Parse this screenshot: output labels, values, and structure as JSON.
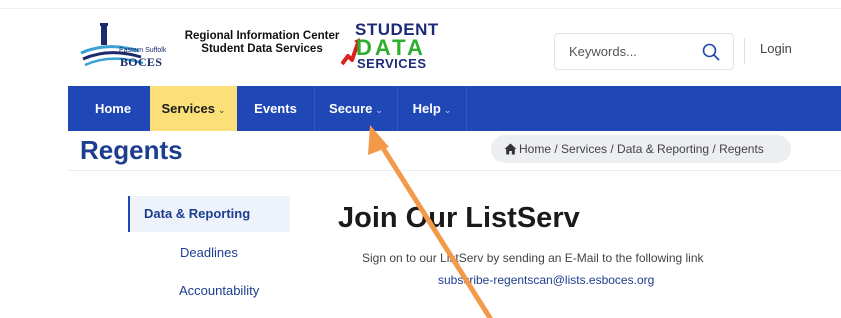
{
  "header": {
    "boces_small": "Eastern Suffolk",
    "boces_big": "BOCES",
    "center_title_line1": "Regional Information Center",
    "center_title_line2": "Student Data Services",
    "sds_logo": {
      "line1": "STUDENT",
      "line2": "DATA",
      "line3": "SERVICES"
    },
    "search": {
      "placeholder": "Keywords..."
    },
    "login_label": "Login"
  },
  "nav": {
    "items": [
      {
        "label": "Home",
        "has_dropdown": false
      },
      {
        "label": "Services",
        "has_dropdown": true,
        "active": true
      },
      {
        "label": "Events",
        "has_dropdown": false
      },
      {
        "label": "Secure",
        "has_dropdown": true
      },
      {
        "label": "Help",
        "has_dropdown": true
      }
    ],
    "dropdown_chevron": "⌄"
  },
  "page": {
    "title": "Regents",
    "breadcrumb": "Home / Services / Data & Reporting / Regents"
  },
  "sidebar": {
    "items": [
      {
        "label": "Data & Reporting",
        "active": true
      },
      {
        "label": "Deadlines"
      },
      {
        "label": "Accountability"
      }
    ]
  },
  "main": {
    "heading": "Join Our ListServ",
    "text": "Sign on to our ListServ by sending an E-Mail to the following link",
    "email": "subscribe-regentscan@lists.esboces.org"
  },
  "colors": {
    "nav_bg": "#1f47b5",
    "nav_active_bg": "#fbe07a",
    "title_color": "#1d3d8f",
    "arrow_color": "#f39a4a"
  },
  "icons": [
    "search-icon",
    "home-icon",
    "chevron-down-icon",
    "annotation-arrow"
  ]
}
